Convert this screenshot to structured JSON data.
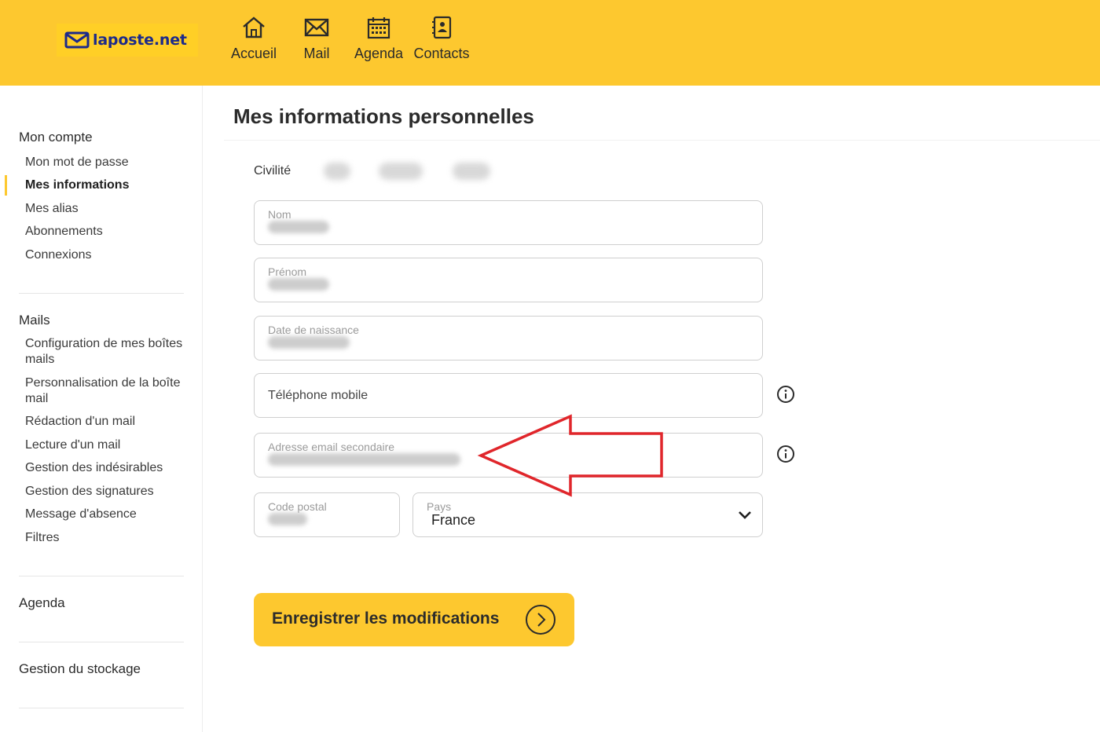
{
  "header": {
    "logo_text": "laposte.net",
    "nav": [
      {
        "label": "Accueil",
        "icon": "home-icon"
      },
      {
        "label": "Mail",
        "icon": "envelope-icon"
      },
      {
        "label": "Agenda",
        "icon": "calendar-icon"
      },
      {
        "label": "Contacts",
        "icon": "contacts-book-icon"
      }
    ]
  },
  "sidebar": {
    "sections": [
      {
        "label": "Mon compte"
      },
      {
        "label": "Mails"
      },
      {
        "label": "Agenda"
      },
      {
        "label": "Gestion du stockage"
      }
    ],
    "account_items": [
      "Mon mot de passe",
      "Mes informations",
      "Mes alias",
      "Abonnements",
      "Connexions"
    ],
    "mail_items": [
      "Configuration de mes boîtes mails",
      "Personnalisation de la boîte mail",
      "Rédaction d'un mail",
      "Lecture d'un mail",
      "Gestion des indésirables",
      "Gestion des signatures",
      "Message d'absence",
      "Filtres"
    ],
    "active_item": "Mes informations"
  },
  "main": {
    "title": "Mes informations personnelles",
    "civility_label": "Civilité",
    "fields": {
      "nom_label": "Nom",
      "prenom_label": "Prénom",
      "naissance_label": "Date de naissance",
      "telephone_placeholder": "Téléphone mobile",
      "email_label": "Adresse email secondaire",
      "code_postal_label": "Code postal",
      "pays_label": "Pays",
      "pays_value": "France"
    },
    "save_button": "Enregistrer les modifications"
  },
  "colors": {
    "brand_yellow": "#fdc82f",
    "logo_blue": "#1c2a8a",
    "annotation_red": "#e0262b"
  }
}
